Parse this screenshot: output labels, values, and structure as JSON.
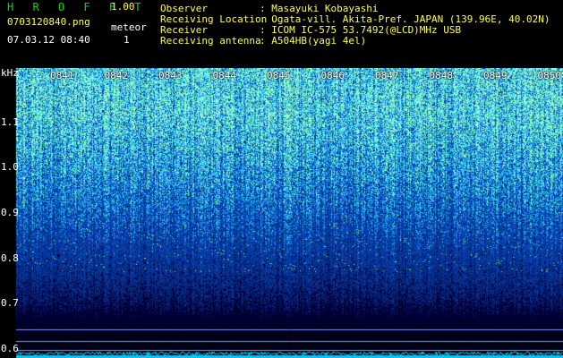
{
  "app": {
    "title": "H R O F F T",
    "version": "1.00"
  },
  "file": {
    "name": "0703120840.png",
    "datetime": "07.03.12 08:40"
  },
  "meteor": {
    "label": "meteor",
    "count": "1"
  },
  "info": [
    {
      "key": "Observer",
      "value": ": Masayuki Kobayashi"
    },
    {
      "key": "Receiving Location",
      "value": ": Ogata-vill. Akita-Pref. JAPAN (139.96E, 40.02N)"
    },
    {
      "key": "Receiver",
      "value": ": ICOM IC-575 53.7492(@LCD)MHz USB"
    },
    {
      "key": "Receiving antenna",
      "value": ": A504HB(yagi 4el)"
    }
  ],
  "chart_data": {
    "type": "heatmap",
    "yunit": "kHz",
    "ylim": [
      0.58,
      1.22
    ],
    "yticks": [
      "1.1",
      "1.0",
      "0.9",
      "0.8",
      "0.7",
      "0.6"
    ],
    "xticks": [
      "0841",
      "0842",
      "0843",
      "0844",
      "0845",
      "0846",
      "0847",
      "0848",
      "0849",
      "0850"
    ],
    "colors": {
      "background": "#000000",
      "low": "#001060",
      "mid": "#2050d0",
      "high": "#40ff80"
    }
  }
}
